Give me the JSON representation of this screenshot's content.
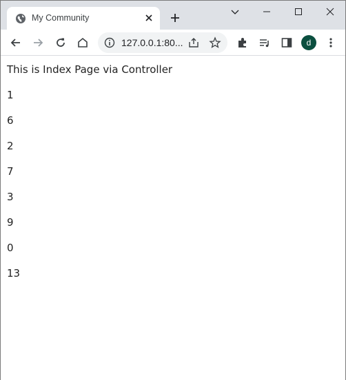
{
  "browser": {
    "tab": {
      "title": "My Community"
    },
    "address_bar": {
      "url": "127.0.0.1:80..."
    },
    "profile": {
      "initial": "d",
      "color": "#0b4f3f"
    }
  },
  "page": {
    "heading": "This is Index Page via Controller",
    "numbers": [
      "1",
      "6",
      "2",
      "7",
      "3",
      "9",
      "0",
      "13"
    ]
  }
}
